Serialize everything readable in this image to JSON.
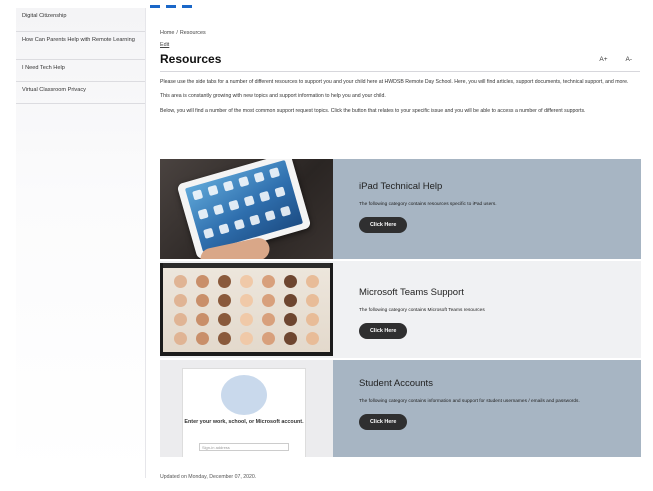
{
  "sidebar": {
    "items": [
      {
        "label": "Digital Citizenship"
      },
      {
        "label": "How Can Parents Help with Remote Learning"
      },
      {
        "label": "I Need Tech Help"
      },
      {
        "label": "Virtual Classroom Privacy"
      }
    ]
  },
  "breadcrumb": {
    "home": "Home",
    "separator": "/",
    "current": "Resources"
  },
  "subnav": {
    "label": "Edit"
  },
  "page": {
    "title": "Resources",
    "font_increase": "A+",
    "font_decrease": "A-",
    "paragraphs": [
      "Please use the side tabs for a number of different resources to support you and your child here at HWDSB Remote Day School. Here, you will find articles, support documents, technical support, and more.",
      "This area is constantly growing with new topics and support information to help you and your child.",
      "Below, you will find a number of the most common support request topics. Click the button that relates to your specific issue and you will be able to access a number of different supports."
    ]
  },
  "cards": [
    {
      "title": "iPad Technical Help",
      "description": "The following category contains resources specific to iPad users.",
      "button": "Click Here",
      "image_icon": "ipad-photo"
    },
    {
      "title": "Microsoft Teams Support",
      "description": "The following category contains Microsoft Teams resources",
      "button": "Click Here",
      "image_icon": "teams-gallery-photo"
    },
    {
      "title": "Student Accounts",
      "description": "The following category contains information and support for student usernames / emails and passwords.",
      "button": "Click Here",
      "image_icon": "sign-in-screenshot",
      "image_text": "Enter your work, school, or Microsoft account.",
      "image_field": "Sign-in address"
    }
  ],
  "footer": {
    "updated": "Updated on Monday, December 07, 2020."
  },
  "colors": {
    "accent_blue": "#1a67c8",
    "card_slate": "#a7b5c3",
    "card_light": "#f0f1f3",
    "button_dark": "#2f2f30"
  }
}
